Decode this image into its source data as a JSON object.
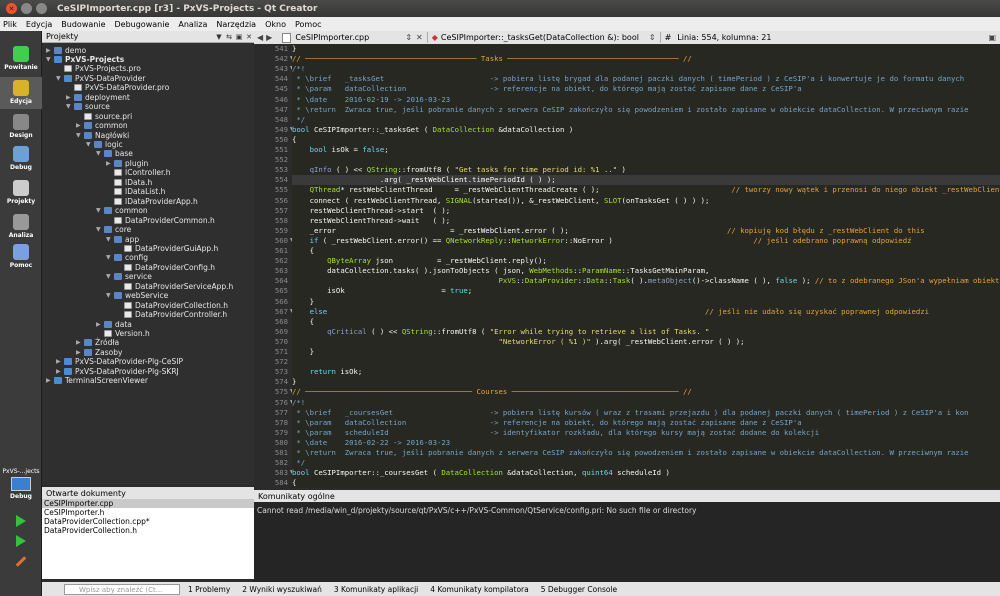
{
  "window": {
    "title": "CeSIPImporter.cpp [r3] - PxVS-Projects - Qt Creator"
  },
  "menu": [
    "Plik",
    "Edycja",
    "Budowanie",
    "Debugowanie",
    "Analiza",
    "Narzędzia",
    "Okno",
    "Pomoc"
  ],
  "modes": [
    {
      "label": "Powitanie",
      "icon": "qt-logo-icon",
      "color": "#41cd52"
    },
    {
      "label": "Edycja",
      "icon": "edit-icon",
      "color": "#d8b32a"
    },
    {
      "label": "Design",
      "icon": "design-icon",
      "color": "#888"
    },
    {
      "label": "Debug",
      "icon": "debug-icon",
      "color": "#6ea0d8"
    },
    {
      "label": "Projekty",
      "icon": "projects-icon",
      "color": "#ccc"
    },
    {
      "label": "Analiza",
      "icon": "analyze-icon",
      "color": "#999"
    },
    {
      "label": "Pomoc",
      "icon": "help-icon",
      "color": "#7aa0e0"
    }
  ],
  "kit": {
    "label": "PxVS-...jects",
    "debug": "Debug"
  },
  "project_panel": {
    "title": "Projekty"
  },
  "tree": [
    {
      "d": 0,
      "t": "demo",
      "k": "fold",
      "a": "▶"
    },
    {
      "d": 0,
      "t": "PxVS-Projects",
      "k": "proj",
      "a": "▼",
      "b": true
    },
    {
      "d": 1,
      "t": "PxVS-Projects.pro",
      "k": "file",
      "a": ""
    },
    {
      "d": 1,
      "t": "PxVS-DataProvider",
      "k": "proj",
      "a": "▼"
    },
    {
      "d": 2,
      "t": "PxVS-DataProvider.pro",
      "k": "file",
      "a": ""
    },
    {
      "d": 2,
      "t": "deployment",
      "k": "fold",
      "a": "▶"
    },
    {
      "d": 2,
      "t": "source",
      "k": "fold",
      "a": "▼"
    },
    {
      "d": 3,
      "t": "source.pri",
      "k": "file",
      "a": ""
    },
    {
      "d": 3,
      "t": "common",
      "k": "fold",
      "a": "▶"
    },
    {
      "d": 3,
      "t": "Nagłówki",
      "k": "fold",
      "a": "▼"
    },
    {
      "d": 4,
      "t": "logic",
      "k": "fold",
      "a": "▼"
    },
    {
      "d": 5,
      "t": "base",
      "k": "fold",
      "a": "▼"
    },
    {
      "d": 6,
      "t": "plugin",
      "k": "fold",
      "a": "▶"
    },
    {
      "d": 6,
      "t": "IController.h",
      "k": "file",
      "a": ""
    },
    {
      "d": 6,
      "t": "IData.h",
      "k": "file",
      "a": ""
    },
    {
      "d": 6,
      "t": "IDataList.h",
      "k": "file",
      "a": ""
    },
    {
      "d": 6,
      "t": "IDataProviderApp.h",
      "k": "file",
      "a": ""
    },
    {
      "d": 5,
      "t": "common",
      "k": "fold",
      "a": "▼"
    },
    {
      "d": 6,
      "t": "DataProviderCommon.h",
      "k": "file",
      "a": ""
    },
    {
      "d": 5,
      "t": "core",
      "k": "fold",
      "a": "▼"
    },
    {
      "d": 6,
      "t": "app",
      "k": "fold",
      "a": "▼"
    },
    {
      "d": 7,
      "t": "DataProviderGuiApp.h",
      "k": "file",
      "a": ""
    },
    {
      "d": 6,
      "t": "config",
      "k": "fold",
      "a": "▼"
    },
    {
      "d": 7,
      "t": "DataProviderConfig.h",
      "k": "file",
      "a": ""
    },
    {
      "d": 6,
      "t": "service",
      "k": "fold",
      "a": "▼"
    },
    {
      "d": 7,
      "t": "DataProviderServiceApp.h",
      "k": "file",
      "a": ""
    },
    {
      "d": 6,
      "t": "webService",
      "k": "fold",
      "a": "▼"
    },
    {
      "d": 7,
      "t": "DataProviderCollection.h",
      "k": "file",
      "a": ""
    },
    {
      "d": 7,
      "t": "DataProviderController.h",
      "k": "file",
      "a": ""
    },
    {
      "d": 5,
      "t": "data",
      "k": "fold",
      "a": "▶"
    },
    {
      "d": 5,
      "t": "Version.h",
      "k": "file",
      "a": ""
    },
    {
      "d": 3,
      "t": "Źródła",
      "k": "fold",
      "a": "▶"
    },
    {
      "d": 3,
      "t": "Zasoby",
      "k": "fold",
      "a": "▶"
    },
    {
      "d": 1,
      "t": "PxVS-DataProvider-Plg-CeSIP",
      "k": "proj",
      "a": "▶"
    },
    {
      "d": 1,
      "t": "PxVS-DataProvider-Plg-SKRJ",
      "k": "proj",
      "a": "▶"
    },
    {
      "d": 0,
      "t": "TerminalScreenViewer",
      "k": "proj",
      "a": "▶"
    }
  ],
  "open_docs": {
    "title": "Otwarte dokumenty",
    "items": [
      "CeSIPImporter.cpp",
      "CeSIPImporter.h",
      "DataProviderCollection.cpp*",
      "DataProviderCollection.h"
    ]
  },
  "editor": {
    "file_tab": "CeSIPImporter.cpp",
    "symbol_tab": "CeSIPImporter::_tasksGet(DataCollection &): bool",
    "hash": "#",
    "position": "Linia: 554, kolumna: 21"
  },
  "code": [
    {
      "n": "541",
      "s": [
        [
          "}",
          "#f8f8f2"
        ]
      ]
    },
    {
      "n": "542",
      "f": "▼",
      "s": [
        [
          "// ─────────────────────────────────────── Tasks ─────────────────────────────────────── //",
          "#e6a23c"
        ]
      ]
    },
    {
      "n": "543",
      "f": "▼",
      "s": [
        [
          "/*!",
          "#75a4c9"
        ]
      ]
    },
    {
      "n": "544",
      "s": [
        [
          " * \\brief   _tasksGet                        -> pobiera listę brygad dla podanej paczki danych ( timePeriod ) z CeSIP'a i konwertuje je do formatu danych",
          "#75a4c9"
        ]
      ]
    },
    {
      "n": "545",
      "s": [
        [
          " * \\param   dataCollection                   -> referencje na obiekt, do którego mają zostać zapisane dane z CeSIP'a",
          "#75a4c9"
        ]
      ]
    },
    {
      "n": "546",
      "s": [
        [
          " * \\date    2016-02-19 -> 2016-03-23",
          "#75a4c9"
        ]
      ]
    },
    {
      "n": "547",
      "s": [
        [
          " * \\return  Zwraca true, jeśli pobranie danych z serwera CeSIP zakończyło się powodzeniem i zostało zapisane w obiekcie dataCollection. W przeciwnym razie",
          "#75a4c9"
        ]
      ]
    },
    {
      "n": "548",
      "s": [
        [
          " */",
          "#75a4c9"
        ]
      ]
    },
    {
      "n": "549",
      "f": "▼",
      "s": [
        [
          "bool ",
          "#66d9ef"
        ],
        [
          "CeSIPImporter",
          "#f8f8f2"
        ],
        [
          "::",
          "#f8f8f2"
        ],
        [
          "_tasksGet",
          "#f8f8f2"
        ],
        [
          " ( ",
          "#f8f8f2"
        ],
        [
          "DataCollection",
          "#a6e22e"
        ],
        [
          " &dataCollection )",
          "#f8f8f2"
        ]
      ]
    },
    {
      "n": "550",
      "s": [
        [
          "{",
          "#f8f8f2"
        ]
      ]
    },
    {
      "n": "551",
      "s": [
        [
          "    bool ",
          "#66d9ef"
        ],
        [
          "isOk = ",
          "#f8f8f2"
        ],
        [
          "false",
          "#66d9ef"
        ],
        [
          ";",
          "#f8f8f2"
        ]
      ]
    },
    {
      "n": "552",
      "s": [
        [
          "",
          "#f8f8f2"
        ]
      ]
    },
    {
      "n": "553",
      "s": [
        [
          "    qInfo",
          "#8ea0c8"
        ],
        [
          " ( ) << ",
          "#f8f8f2"
        ],
        [
          "QString",
          "#a6e22e"
        ],
        [
          "::fromUtf8 ( ",
          "#f8f8f2"
        ],
        [
          "\"Get tasks for time period id: %1 ..\"",
          "#e6db74"
        ],
        [
          " )",
          "#f8f8f2"
        ]
      ]
    },
    {
      "n": "554",
      "cur": true,
      "s": [
        [
          "                    .arg( ",
          "#f8f8f2"
        ],
        [
          "_restWebClient",
          "#ffffff"
        ],
        [
          ".timePeriodId ( ) );",
          "#f8f8f2"
        ]
      ]
    },
    {
      "n": "555",
      "s": [
        [
          "    QThread",
          "#a6e22e"
        ],
        [
          "* restWebClientThread     = _restWebClientThreadCreate ( );                              ",
          "#f8f8f2"
        ],
        [
          "// tworzy nowy wątek i przenosi do niego obiekt _restWebClient",
          "#e6a23c"
        ]
      ]
    },
    {
      "n": "556",
      "s": [
        [
          "    connect ( restWebClientThread, ",
          "#f8f8f2"
        ],
        [
          "SIGNAL",
          "#a6e22e"
        ],
        [
          "(started()), &",
          "#f8f8f2"
        ],
        [
          "_restWebClient",
          "#ffffff"
        ],
        [
          ", ",
          "#f8f8f2"
        ],
        [
          "SLOT",
          "#a6e22e"
        ],
        [
          "(onTasksGet ( ) ) );",
          "#f8f8f2"
        ]
      ]
    },
    {
      "n": "557",
      "s": [
        [
          "    restWebClientThread->start  ( );",
          "#f8f8f2"
        ]
      ]
    },
    {
      "n": "558",
      "s": [
        [
          "    restWebClientThread->wait   ( );",
          "#f8f8f2"
        ]
      ]
    },
    {
      "n": "559",
      "s": [
        [
          "    _error",
          "#ffffff"
        ],
        [
          "                          = ",
          "#f8f8f2"
        ],
        [
          "_restWebClient",
          "#ffffff"
        ],
        [
          ".error ( );                                    ",
          "#f8f8f2"
        ],
        [
          "// kopiuję kod błędu z _restWebClient do this",
          "#e6a23c"
        ]
      ]
    },
    {
      "n": "560",
      "f": "▼",
      "s": [
        [
          "    if",
          "#66d9ef"
        ],
        [
          " ( ",
          "#f8f8f2"
        ],
        [
          "_restWebClient",
          "#ffffff"
        ],
        [
          ".error() == ",
          "#f8f8f2"
        ],
        [
          "QNetworkReply",
          "#a6e22e"
        ],
        [
          "::",
          "#f8f8f2"
        ],
        [
          "NetworkError",
          "#a6e22e"
        ],
        [
          "::NoError )                                ",
          "#f8f8f2"
        ],
        [
          "// jeśli odebrano poprawną odpowiedź",
          "#e6a23c"
        ]
      ]
    },
    {
      "n": "561",
      "s": [
        [
          "    {",
          "#f8f8f2"
        ]
      ]
    },
    {
      "n": "562",
      "s": [
        [
          "        QByteArray",
          "#a6e22e"
        ],
        [
          " json          = ",
          "#f8f8f2"
        ],
        [
          "_restWebClient",
          "#ffffff"
        ],
        [
          ".reply();",
          "#f8f8f2"
        ]
      ]
    },
    {
      "n": "563",
      "s": [
        [
          "        dataCollection.tasks( ).jsonToObjects ( json, ",
          "#f8f8f2"
        ],
        [
          "WebMethods",
          "#a6e22e"
        ],
        [
          "::",
          "#f8f8f2"
        ],
        [
          "ParamName",
          "#a6e22e"
        ],
        [
          "::TasksGetMainParam,",
          "#f8f8f2"
        ]
      ]
    },
    {
      "n": "564",
      "s": [
        [
          "                                               ",
          "#f8f8f2"
        ],
        [
          "PxVS",
          "#a6e22e"
        ],
        [
          "::",
          "#f8f8f2"
        ],
        [
          "DataProvider",
          "#a6e22e"
        ],
        [
          "::",
          "#f8f8f2"
        ],
        [
          "Data",
          "#a6e22e"
        ],
        [
          "::",
          "#f8f8f2"
        ],
        [
          "Task",
          "#a6e22e"
        ],
        [
          "( ).",
          "#f8f8f2"
        ],
        [
          "metaObject",
          "#8ea0c8"
        ],
        [
          "()->className ( ), ",
          "#f8f8f2"
        ],
        [
          "false",
          "#66d9ef"
        ],
        [
          " ); ",
          "#f8f8f2"
        ],
        [
          "// to z odebranego JSon'a wypełniam obiekt dataCollection",
          "#e6a23c"
        ]
      ]
    },
    {
      "n": "565",
      "s": [
        [
          "        isOk                      = ",
          "#f8f8f2"
        ],
        [
          "true",
          "#66d9ef"
        ],
        [
          ";",
          "#f8f8f2"
        ]
      ]
    },
    {
      "n": "566",
      "s": [
        [
          "    }",
          "#f8f8f2"
        ]
      ]
    },
    {
      "n": "567",
      "f": "▼",
      "s": [
        [
          "    else",
          "#66d9ef"
        ],
        [
          "                                                                                      ",
          "#f8f8f2"
        ],
        [
          "// jeśli nie udało się uzyskać poprawnej odpowiedzi",
          "#e6a23c"
        ]
      ]
    },
    {
      "n": "568",
      "s": [
        [
          "    {",
          "#f8f8f2"
        ]
      ]
    },
    {
      "n": "569",
      "s": [
        [
          "        qCritical",
          "#8ea0c8"
        ],
        [
          " ( ) << ",
          "#f8f8f2"
        ],
        [
          "QString",
          "#a6e22e"
        ],
        [
          "::fromUtf8 ( ",
          "#f8f8f2"
        ],
        [
          "\"Error while trying to retrieve a list of Tasks. \"",
          "#e6db74"
        ]
      ]
    },
    {
      "n": "570",
      "s": [
        [
          "                                               ",
          "#f8f8f2"
        ],
        [
          "\"NetworkError ( %1 )\"",
          "#e6db74"
        ],
        [
          " ).arg( ",
          "#f8f8f2"
        ],
        [
          "_restWebClient",
          "#ffffff"
        ],
        [
          ".error ( ) );",
          "#f8f8f2"
        ]
      ]
    },
    {
      "n": "571",
      "s": [
        [
          "    }",
          "#f8f8f2"
        ]
      ]
    },
    {
      "n": "572",
      "s": [
        [
          "",
          "#f8f8f2"
        ]
      ]
    },
    {
      "n": "573",
      "s": [
        [
          "    return ",
          "#66d9ef"
        ],
        [
          "isOk;",
          "#f8f8f2"
        ]
      ]
    },
    {
      "n": "574",
      "s": [
        [
          "}",
          "#f8f8f2"
        ]
      ]
    },
    {
      "n": "575",
      "f": "▼",
      "s": [
        [
          "// ────────────────────────────────────── Courses ────────────────────────────────────── //",
          "#e6a23c"
        ]
      ]
    },
    {
      "n": "576",
      "f": "▼",
      "s": [
        [
          "/*!",
          "#75a4c9"
        ]
      ]
    },
    {
      "n": "577",
      "s": [
        [
          " * \\brief   _coursesGet                      -> pobiera listę kursów ( wraz z trasami przejazdu ) dla podanej paczki danych ( timePeriod ) z CeSIP'a i kon",
          "#75a4c9"
        ]
      ]
    },
    {
      "n": "578",
      "s": [
        [
          " * \\param   dataCollection                   -> referencje na obiekt, do którego mają zostać zapisane dane z CeSIP'a",
          "#75a4c9"
        ]
      ]
    },
    {
      "n": "579",
      "s": [
        [
          " * \\param   scheduleId                       -> identyfikator rozkładu, dla którego kursy mają zostać dodane do kolekcji",
          "#75a4c9"
        ]
      ]
    },
    {
      "n": "580",
      "s": [
        [
          " * \\date    2016-02-22 -> 2016-03-23",
          "#75a4c9"
        ]
      ]
    },
    {
      "n": "581",
      "s": [
        [
          " * \\return  Zwraca true, jeśli pobranie danych z serwera CeSIP zakończyło się powodzeniem i zostało zapisane w obiekcie dataCollection. W przeciwnym razie",
          "#75a4c9"
        ]
      ]
    },
    {
      "n": "582",
      "s": [
        [
          " */",
          "#75a4c9"
        ]
      ]
    },
    {
      "n": "583",
      "f": "▼",
      "s": [
        [
          "bool ",
          "#66d9ef"
        ],
        [
          "CeSIPImporter::_coursesGet ( ",
          "#f8f8f2"
        ],
        [
          "DataCollection",
          "#a6e22e"
        ],
        [
          " &dataCollection, ",
          "#f8f8f2"
        ],
        [
          "quint64",
          "#66d9ef"
        ],
        [
          " scheduleId )",
          "#f8f8f2"
        ]
      ]
    },
    {
      "n": "584",
      "s": [
        [
          "{",
          "#f8f8f2"
        ]
      ]
    }
  ],
  "output": {
    "title": "Komunikaty ogólne",
    "message": "Cannot read /media/win_d/projekty/source/qt/PxVS/c++/PxVS-Common/QtService/config.pri: No such file or directory"
  },
  "status": {
    "search_placeholder": "Wpisz aby znaleźć (Ct...",
    "panes": [
      "1  Problemy",
      "2  Wyniki wyszukiwań",
      "3  Komunikaty aplikacji",
      "4  Komunikaty kompilatora",
      "5  Debugger Console"
    ]
  }
}
